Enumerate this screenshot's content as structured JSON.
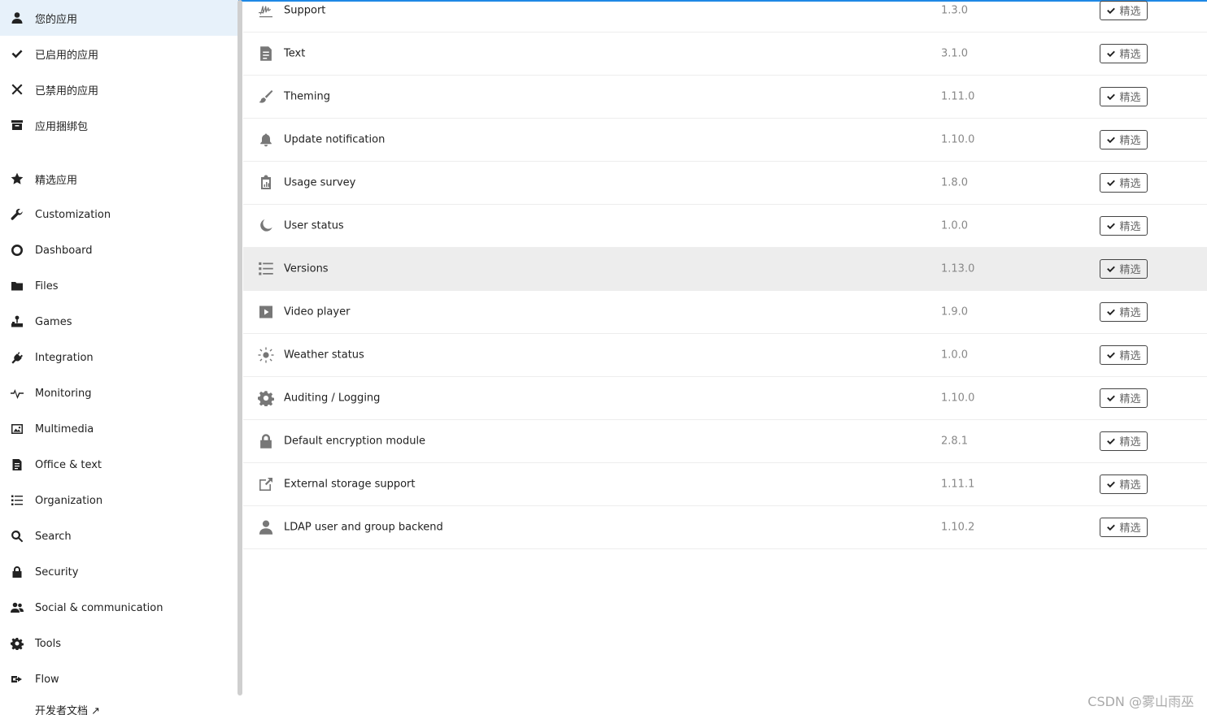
{
  "sidebar": {
    "top_items": [
      {
        "label": "您的应用",
        "icon": "user-icon",
        "active": true
      },
      {
        "label": "已启用的应用",
        "icon": "check-icon"
      },
      {
        "label": "已禁用的应用",
        "icon": "close-icon"
      },
      {
        "label": "应用捆绑包",
        "icon": "archive-icon"
      }
    ],
    "category_items": [
      {
        "label": "精选应用",
        "icon": "star-icon"
      },
      {
        "label": "Customization",
        "icon": "wrench-icon"
      },
      {
        "label": "Dashboard",
        "icon": "circle-icon"
      },
      {
        "label": "Files",
        "icon": "folder-icon"
      },
      {
        "label": "Games",
        "icon": "joystick-icon"
      },
      {
        "label": "Integration",
        "icon": "plug-icon"
      },
      {
        "label": "Monitoring",
        "icon": "pulse-icon"
      },
      {
        "label": "Multimedia",
        "icon": "image-icon"
      },
      {
        "label": "Office & text",
        "icon": "document-icon"
      },
      {
        "label": "Organization",
        "icon": "list-icon"
      },
      {
        "label": "Search",
        "icon": "search-icon"
      },
      {
        "label": "Security",
        "icon": "lock-icon"
      },
      {
        "label": "Social & communication",
        "icon": "users-icon"
      },
      {
        "label": "Tools",
        "icon": "gear-icon"
      },
      {
        "label": "Flow",
        "icon": "flow-icon"
      },
      {
        "label": "开发者文档 ↗",
        "icon": "none"
      }
    ]
  },
  "apps": [
    {
      "name": "Support",
      "version": "1.3.0",
      "icon": "signature-icon",
      "action": "精选"
    },
    {
      "name": "Text",
      "version": "3.1.0",
      "icon": "document-icon",
      "action": "精选"
    },
    {
      "name": "Theming",
      "version": "1.11.0",
      "icon": "brush-icon",
      "action": "精选"
    },
    {
      "name": "Update notification",
      "version": "1.10.0",
      "icon": "bell-icon",
      "action": "精选"
    },
    {
      "name": "Usage survey",
      "version": "1.8.0",
      "icon": "clipboard-chart-icon",
      "action": "精选"
    },
    {
      "name": "User status",
      "version": "1.0.0",
      "icon": "moon-icon",
      "action": "精选"
    },
    {
      "name": "Versions",
      "version": "1.13.0",
      "icon": "list-icon",
      "action": "精选",
      "highlight": true
    },
    {
      "name": "Video player",
      "version": "1.9.0",
      "icon": "play-icon",
      "action": "精选"
    },
    {
      "name": "Weather status",
      "version": "1.0.0",
      "icon": "sun-icon",
      "action": "精选"
    },
    {
      "name": "Auditing / Logging",
      "version": "1.10.0",
      "icon": "gear-icon",
      "action": "精选"
    },
    {
      "name": "Default encryption module",
      "version": "2.8.1",
      "icon": "lock-icon",
      "action": "精选"
    },
    {
      "name": "External storage support",
      "version": "1.11.1",
      "icon": "external-link-icon",
      "action": "精选"
    },
    {
      "name": "LDAP user and group backend",
      "version": "1.10.2",
      "icon": "user-icon",
      "action": "精选"
    }
  ],
  "watermark": "CSDN @雾山雨巫",
  "colors": {
    "accent": "#1e88e5",
    "active_bg": "#e7f1fa",
    "row_highlight": "#ededed"
  }
}
